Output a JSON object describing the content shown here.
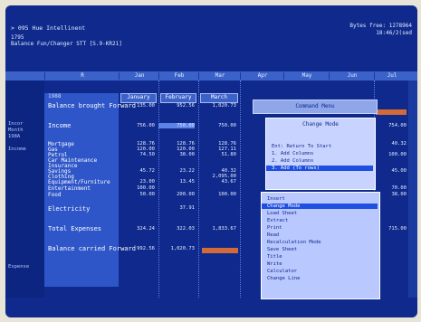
{
  "header": {
    "top_left": "> 095  Hue  Intellinent",
    "top_right_1": "Bytes free: 1278964",
    "top_right_2": "18:46/2(sed",
    "line1": "1795",
    "line2": "Balance  Fun/Changer  STT  [S.9-KR21]"
  },
  "columns": {
    "row_label_header": "R",
    "months": [
      "Jan",
      "Feb",
      "Mar",
      "Apr",
      "May",
      "Jun",
      "Jul"
    ]
  },
  "margin": {
    "labels": [
      "Incor",
      "Month",
      "198A",
      "Income",
      "Expense"
    ]
  },
  "rows": {
    "year_label": "1988",
    "month_headers": [
      "January",
      "February",
      "March"
    ],
    "balance_brought_forward": "Balance brought Forward",
    "income": "Income",
    "mortgage": "Mortgage",
    "gas": "Gas",
    "petrol": "Petrol",
    "car_maintenance": "Car Maintenance",
    "insurance": "Insurance",
    "savings": "Savings",
    "clothing": "Clothing",
    "equipment": "Equipment/Furniture",
    "entertainment": "Entertainment",
    "food": "Food",
    "electricity": "Electricity",
    "total_expenses": "Total Expenses",
    "balance_carried_forward": "Balance carried Forward"
  },
  "values": {
    "jan": [
      "135.00",
      "756.00",
      "128.76",
      "120.00",
      "74.50",
      "45.72",
      "23.00",
      "100.00",
      "50.00",
      "324.24",
      "992.56"
    ],
    "feb": [
      "952.56",
      "750.00",
      "128.76",
      "120.00",
      "38.00",
      "23.22",
      "13.45",
      "200.00",
      "37.91",
      "322.03",
      "1,020.73"
    ],
    "mar": [
      "1,020.73",
      "750.00",
      "128.76",
      "127.11",
      "51.80",
      "40.32",
      "2,095.00",
      "43.67",
      "100.00",
      "1,833.67"
    ],
    "jul": [
      "754.00",
      "40.32",
      "100.00",
      "45.00",
      "70.00",
      "38.00",
      "715.00"
    ]
  },
  "command_menu": {
    "title": "Command Menu",
    "submenu_title": "Change Mode",
    "submenu_items": [
      "Ent:  Return To Start",
      "1.   Add Columns",
      "2.   Add Columns",
      "3.   Add (To rows)"
    ],
    "items": [
      "Insert",
      "Change Mode",
      "Load Sheet",
      "Extract",
      "Print",
      "Read",
      "Recalculation Mode",
      "Save Sheet",
      "Title",
      "Write",
      "Calculator",
      "Change Line"
    ],
    "selected_item": "Change Mode"
  }
}
